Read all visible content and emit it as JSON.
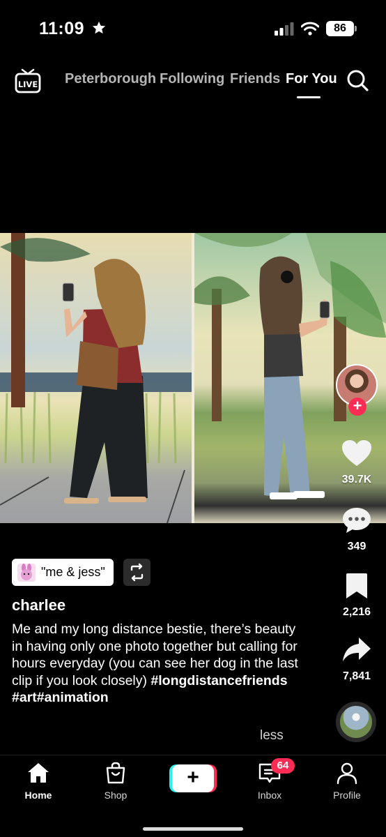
{
  "status_bar": {
    "time": "11:09",
    "battery": "86"
  },
  "top_nav": {
    "live_label": "LIVE",
    "tabs": [
      "Peterborough",
      "Following",
      "Friends",
      "For You"
    ],
    "active_tab": "For You"
  },
  "actions": {
    "likes": "39.7K",
    "comments": "349",
    "saves": "2,216",
    "shares": "7,841"
  },
  "post": {
    "sound_title": "\"me & jess\"",
    "username": "charlee",
    "caption_text": "Me and my long distance bestie, there’s beauty in having only one photo together but calling for hours everyday (you can see her dog in the last clip if you look closely) ",
    "hashtags": "#longdistancefriends #art#animation",
    "less_label": "less"
  },
  "bottom_nav": {
    "home": "Home",
    "shop": "Shop",
    "inbox": "Inbox",
    "inbox_badge": "64",
    "profile": "Profile"
  },
  "colors": {
    "accent_red": "#fe2c55",
    "accent_cyan": "#25f4ee",
    "background": "#000000"
  }
}
